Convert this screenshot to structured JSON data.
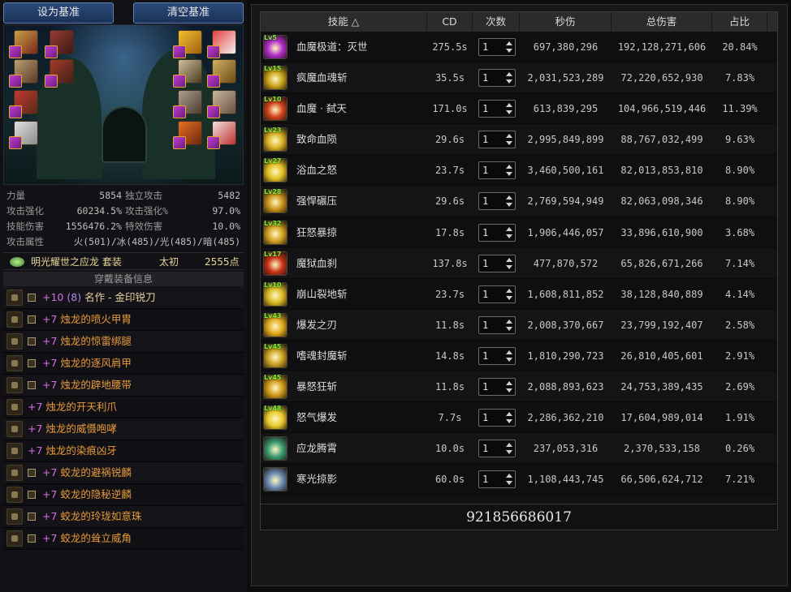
{
  "left": {
    "buttons": {
      "set_baseline": "设为基准",
      "clear_baseline": "清空基准"
    },
    "stats": [
      {
        "label": "力量",
        "value": "5854",
        "label2": "独立攻击",
        "value2": "5482"
      },
      {
        "label": "攻击强化",
        "value": "60234.5%",
        "label2": "攻击强化%",
        "value2": "97.0%"
      },
      {
        "label": "技能伤害",
        "value": "1556476.2%",
        "label2": "特效伤害",
        "value2": "10.0%"
      },
      {
        "label": "攻击属性",
        "value": "火(501)/冰(485)/光(485)/暗(485)",
        "label2": "",
        "value2": ""
      }
    ],
    "set": {
      "name": "明光耀世之应龙 套装",
      "tier": "太初",
      "points": "2555点"
    },
    "equip_header": "穿戴装备信息",
    "equipment": [
      {
        "plus": "+10",
        "level": "(8)",
        "name": "名作 - 金印锐刀",
        "box": true,
        "icon": "weapon-icon"
      },
      {
        "plus": "+7",
        "level": "",
        "name": "烛龙的喷火甲胄",
        "box": true,
        "icon": "armor-icon"
      },
      {
        "plus": "+7",
        "level": "",
        "name": "烛龙的惊雷绑腿",
        "box": true,
        "icon": "pants-icon"
      },
      {
        "plus": "+7",
        "level": "",
        "name": "烛龙的逐风肩甲",
        "box": true,
        "icon": "shoulder-icon"
      },
      {
        "plus": "+7",
        "level": "",
        "name": "烛龙的辟地腰带",
        "box": true,
        "icon": "belt-icon"
      },
      {
        "plus": "+7",
        "level": "",
        "name": "烛龙的开天利爪",
        "box": false,
        "icon": "claw-icon"
      },
      {
        "plus": "+7",
        "level": "",
        "name": "烛龙的威慑咆哮",
        "box": false,
        "icon": "roar-icon"
      },
      {
        "plus": "+7",
        "level": "",
        "name": "烛龙的染痕凶牙",
        "box": false,
        "icon": "fang-icon"
      },
      {
        "plus": "+7",
        "level": "",
        "name": "蛟龙的避祸锐麟",
        "box": true,
        "icon": "ring-icon"
      },
      {
        "plus": "+7",
        "level": "",
        "name": "蛟龙的隐秘逆麟",
        "box": true,
        "icon": "bracelet-icon"
      },
      {
        "plus": "+7",
        "level": "",
        "name": "蛟龙的玲珑如意珠",
        "box": true,
        "icon": "gem-icon"
      },
      {
        "plus": "+7",
        "level": "",
        "name": "蛟龙的耸立威角",
        "box": true,
        "icon": "horn-icon"
      }
    ]
  },
  "table": {
    "headers": {
      "skill": "技能 △",
      "cd": "CD",
      "count": "次数",
      "dps": "秒伤",
      "total": "总伤害",
      "pct": "占比"
    },
    "rows": [
      {
        "lv": "Lv5",
        "name": "血魔极道：灭世",
        "cd": "275.5s",
        "count": "1",
        "dps": "697,380,296",
        "total": "192,128,271,606",
        "pct": "20.84%",
        "color": "#b02cc8"
      },
      {
        "lv": "Lv15",
        "name": "疯魔血魂斩",
        "cd": "35.5s",
        "count": "1",
        "dps": "2,031,523,289",
        "total": "72,220,652,930",
        "pct": "7.83%",
        "color": "#c8a018"
      },
      {
        "lv": "Lv10",
        "name": "血魔 · 弑天",
        "cd": "171.0s",
        "count": "1",
        "dps": "613,839,295",
        "total": "104,966,519,446",
        "pct": "11.39%",
        "color": "#d04018"
      },
      {
        "lv": "Lv23",
        "name": "致命血陨",
        "cd": "29.6s",
        "count": "1",
        "dps": "2,995,849,899",
        "total": "88,767,032,499",
        "pct": "9.63%",
        "color": "#d8b020"
      },
      {
        "lv": "Lv27",
        "name": "浴血之怒",
        "cd": "23.7s",
        "count": "1",
        "dps": "3,460,500,161",
        "total": "82,013,853,810",
        "pct": "8.90%",
        "color": "#e0c020"
      },
      {
        "lv": "Lv28",
        "name": "强悍碾压",
        "cd": "29.6s",
        "count": "1",
        "dps": "2,769,594,949",
        "total": "82,063,098,346",
        "pct": "8.90%",
        "color": "#c89018"
      },
      {
        "lv": "Lv32",
        "name": "狂怒暴掠",
        "cd": "17.8s",
        "count": "1",
        "dps": "1,906,446,057",
        "total": "33,896,610,900",
        "pct": "3.68%",
        "color": "#d0a020"
      },
      {
        "lv": "Lv17",
        "name": "魔狱血刹",
        "cd": "137.8s",
        "count": "1",
        "dps": "477,870,572",
        "total": "65,826,671,266",
        "pct": "7.14%",
        "color": "#c83018"
      },
      {
        "lv": "Lv10",
        "name": "崩山裂地斩",
        "cd": "23.7s",
        "count": "1",
        "dps": "1,608,811,852",
        "total": "38,128,840,889",
        "pct": "4.14%",
        "color": "#d8b820"
      },
      {
        "lv": "Lv43",
        "name": "爆发之刃",
        "cd": "11.8s",
        "count": "1",
        "dps": "2,008,370,667",
        "total": "23,799,192,407",
        "pct": "2.58%",
        "color": "#e0a818"
      },
      {
        "lv": "Lv45",
        "name": "嗜魂封魔斩",
        "cd": "14.8s",
        "count": "1",
        "dps": "1,810,290,723",
        "total": "26,810,405,601",
        "pct": "2.91%",
        "color": "#c8a020"
      },
      {
        "lv": "Lv45",
        "name": "暴怒狂斩",
        "cd": "11.8s",
        "count": "1",
        "dps": "2,088,893,623",
        "total": "24,753,389,435",
        "pct": "2.69%",
        "color": "#d09818"
      },
      {
        "lv": "Lv48",
        "name": "怒气爆发",
        "cd": "7.7s",
        "count": "1",
        "dps": "2,286,362,210",
        "total": "17,604,989,014",
        "pct": "1.91%",
        "color": "#e8c828"
      },
      {
        "lv": "",
        "name": "应龙腾霄",
        "cd": "10.0s",
        "count": "1",
        "dps": "237,053,316",
        "total": "2,370,533,158",
        "pct": "0.26%",
        "color": "#3a9a70"
      },
      {
        "lv": "",
        "name": "寒光掠影",
        "cd": "60.0s",
        "count": "1",
        "dps": "1,108,443,745",
        "total": "66,506,624,712",
        "pct": "7.21%",
        "color": "#6a8ab0"
      }
    ],
    "grand_total": "921856686017"
  }
}
